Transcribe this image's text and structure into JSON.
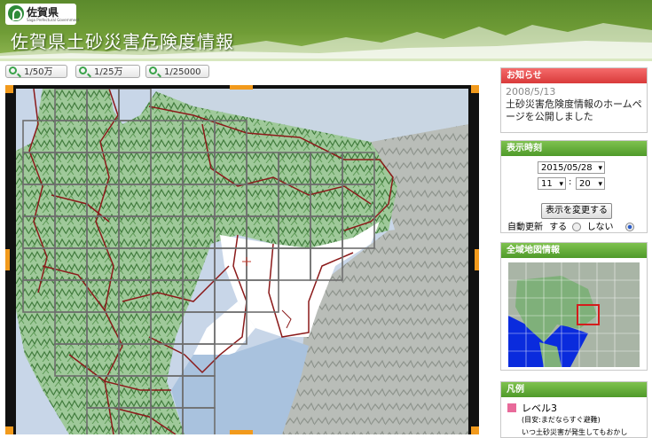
{
  "header": {
    "logo_name": "佐賀県",
    "logo_sub": "Saga Prefectural Government",
    "title": "佐賀県土砂災害危険度情報"
  },
  "zoom": {
    "buttons": [
      "1/50万",
      "1/25万",
      "1/25000"
    ]
  },
  "news": {
    "heading": "お知らせ",
    "date": "2008/5/13",
    "text": "土砂災害危険度情報のホームページを公開しました"
  },
  "display_time": {
    "heading": "表示時刻",
    "date": "2015/05/28",
    "hour": "11",
    "separator": ":",
    "minute": "20",
    "apply_button": "表示を変更する",
    "auto_update_label": "自動更新",
    "on_label": "する",
    "off_label": "しない",
    "selected": "しない"
  },
  "overview": {
    "heading": "全域地図情報"
  },
  "legend": {
    "heading": "凡例",
    "items": [
      {
        "label": "レベル3",
        "note": "(目安:まだならすぐ避難)",
        "color": "#e86a9a"
      }
    ],
    "truncated_text": "いつ土砂災害が発生してもおかし"
  },
  "colors": {
    "header_green": "#6f9c36",
    "news_red": "#d93a3a",
    "panel_green": "#4f9a2a",
    "boundary": "#8b1a1a",
    "grid": "#6e6e6e",
    "map_frame_corner": "#f29a1c"
  }
}
